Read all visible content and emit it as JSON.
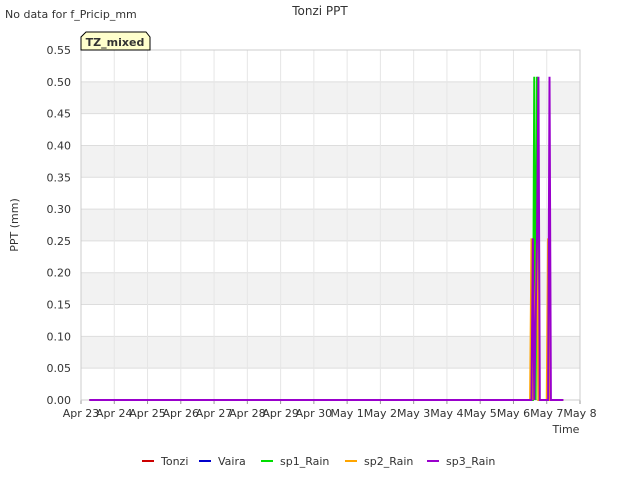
{
  "header": {
    "note": "No data for f_Pricip_mm",
    "title": "Tonzi PPT"
  },
  "badge": {
    "text": "TZ_mixed",
    "text_color": "#8b0000",
    "fill": "#ffffcc"
  },
  "chart_data": {
    "type": "line",
    "title": "Tonzi PPT",
    "xlabel": "Time",
    "ylabel": "PPT (mm)",
    "ylim": [
      0,
      0.55
    ],
    "yticks": [
      0.0,
      0.05,
      0.1,
      0.15,
      0.2,
      0.25,
      0.3,
      0.35,
      0.4,
      0.45,
      0.5,
      0.55
    ],
    "ytick_labels": [
      "0.00",
      "0.05",
      "0.10",
      "0.15",
      "0.20",
      "0.25",
      "0.30",
      "0.35",
      "0.40",
      "0.45",
      "0.50",
      "0.55"
    ],
    "xlim": [
      "2024-04-23",
      "2024-05-08"
    ],
    "xtick_labels": [
      "Apr 23",
      "Apr 24",
      "Apr 25",
      "Apr 26",
      "Apr 27",
      "Apr 28",
      "Apr 29",
      "Apr 30",
      "May 1",
      "May 2",
      "May 3",
      "May 4",
      "May 5",
      "May 6",
      "May 7",
      "May 8"
    ],
    "grid": true,
    "band_fill": "#f2f2f2",
    "legend_position": "bottom",
    "series": [
      {
        "name": "Tonzi",
        "color": "#cc0000",
        "points": []
      },
      {
        "name": "Vaira",
        "color": "#0000cc",
        "points": []
      },
      {
        "name": "sp1_Rain",
        "color": "#00dd00",
        "points": [
          [
            "2024-04-23 06:00",
            0
          ],
          [
            "2024-05-06 14:00",
            0
          ],
          [
            "2024-05-06 15:00",
            0.508
          ],
          [
            "2024-05-06 16:00",
            0
          ],
          [
            "2024-05-06 17:00",
            0.508
          ],
          [
            "2024-05-06 18:00",
            0
          ],
          [
            "2024-05-07 12:00",
            0
          ]
        ]
      },
      {
        "name": "sp2_Rain",
        "color": "#ffa500",
        "points": [
          [
            "2024-04-23 06:00",
            0
          ],
          [
            "2024-05-06 12:00",
            0
          ],
          [
            "2024-05-06 13:00",
            0.254
          ],
          [
            "2024-05-06 14:00",
            0
          ],
          [
            "2024-05-06 17:00",
            0.254
          ],
          [
            "2024-05-06 18:00",
            0
          ],
          [
            "2024-05-07 00:00",
            0
          ],
          [
            "2024-05-07 01:00",
            0.254
          ],
          [
            "2024-05-07 02:00",
            0
          ],
          [
            "2024-05-07 12:00",
            0
          ]
        ]
      },
      {
        "name": "sp3_Rain",
        "color": "#9900cc",
        "points": [
          [
            "2024-04-23 06:00",
            0
          ],
          [
            "2024-05-06 13:00",
            0
          ],
          [
            "2024-05-06 14:00",
            0.254
          ],
          [
            "2024-05-06 15:00",
            0
          ],
          [
            "2024-05-06 17:00",
            0.254
          ],
          [
            "2024-05-06 18:00",
            0.508
          ],
          [
            "2024-05-06 19:00",
            0
          ],
          [
            "2024-05-07 01:00",
            0
          ],
          [
            "2024-05-07 02:00",
            0.508
          ],
          [
            "2024-05-07 03:00",
            0
          ],
          [
            "2024-05-07 12:00",
            0
          ]
        ]
      }
    ]
  }
}
